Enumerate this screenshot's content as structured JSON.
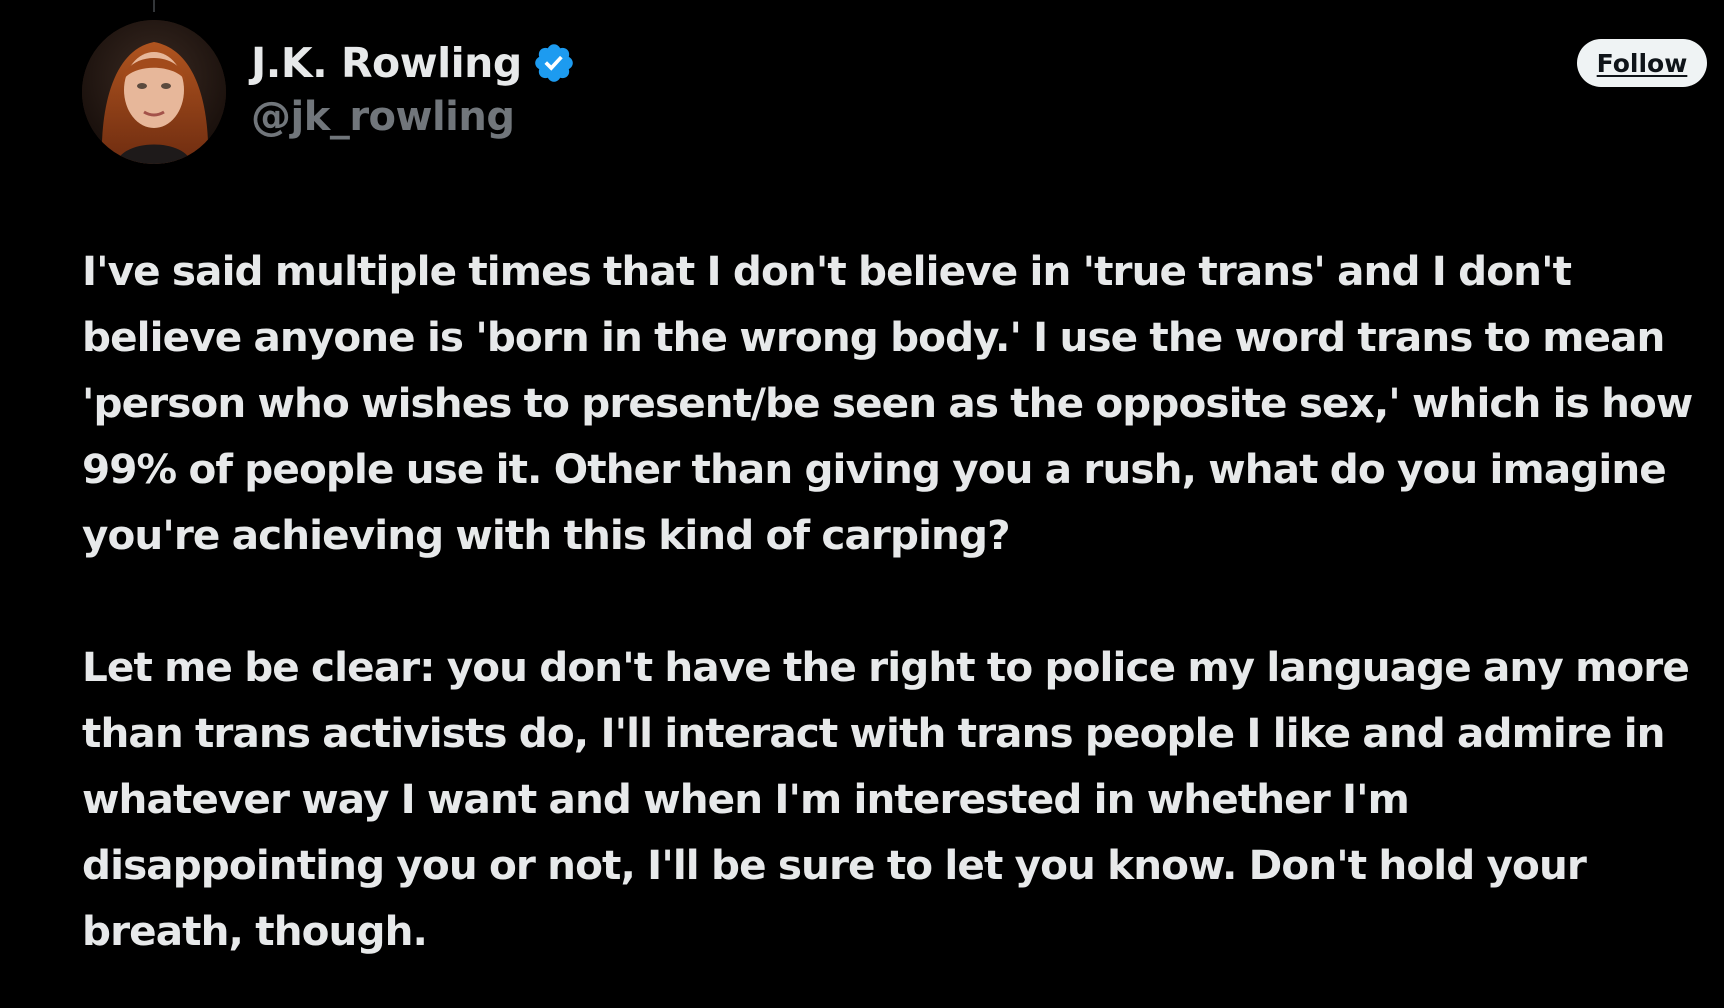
{
  "author": {
    "display_name": "J.K. Rowling",
    "handle": "@jk_rowling",
    "verified_icon": "verified-badge-icon",
    "avatar_icon": "profile-photo"
  },
  "actions": {
    "follow_label": "Follow"
  },
  "tweet": {
    "paragraphs": [
      "I've said multiple times that I don't believe in 'true trans' and I don't believe anyone is 'born in the wrong body.' I use the word trans to mean 'person who wishes to present/be seen as the opposite sex,' which is how 99% of people use it. Other than giving you a rush, what do you imagine you're achieving with this kind of carping?",
      "Let me be clear: you don't have the right to police my language any more than trans activists do, I'll interact with trans people I like and admire in whatever way I want and when I'm interested in whether I'm disappointing you or not, I'll be sure to let you know. Don't hold your breath, though."
    ]
  },
  "colors": {
    "background": "#000000",
    "text_primary": "#e7e9ea",
    "text_secondary": "#71767b",
    "verified_blue": "#1d9bf0",
    "follow_bg": "#eff3f4"
  }
}
